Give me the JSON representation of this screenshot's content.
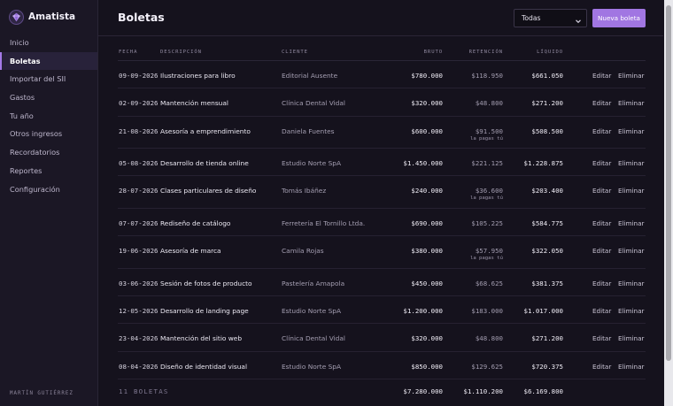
{
  "app": {
    "name": "Amatista"
  },
  "sidebar": {
    "items": [
      {
        "label": "Inicio",
        "name": "inicio"
      },
      {
        "label": "Boletas",
        "name": "boletas",
        "active": true
      },
      {
        "label": "Importar del SII",
        "name": "importar-sii"
      },
      {
        "label": "Gastos",
        "name": "gastos"
      },
      {
        "label": "Tu año",
        "name": "tu-ano"
      },
      {
        "label": "Otros ingresos",
        "name": "otros-ingresos"
      },
      {
        "label": "Recordatorios",
        "name": "recordatorios"
      },
      {
        "label": "Reportes",
        "name": "reportes"
      },
      {
        "label": "Configuración",
        "name": "configuracion"
      }
    ],
    "user": "MARTÍN GUTIÉRREZ"
  },
  "header": {
    "title": "Boletas",
    "filter_value": "Todas",
    "new_button": "Nueva boleta"
  },
  "table": {
    "columns": {
      "fecha": "FECHA",
      "descripcion": "DESCRIPCIÓN",
      "cliente": "CLIENTE",
      "bruto": "BRUTO",
      "retencion": "RETENCIÓN",
      "liquido": "LÍQUIDO"
    },
    "edit_label": "Editar",
    "delete_label": "Eliminar",
    "rows": [
      {
        "fecha": "09-09-2026",
        "descripcion": "Ilustraciones para libro",
        "cliente": "Editorial Ausente",
        "bruto": "$780.000",
        "retencion": "$118.950",
        "liquido": "$661.050",
        "nota": ""
      },
      {
        "fecha": "02-09-2026",
        "descripcion": "Mantención mensual",
        "cliente": "Clínica Dental Vidal",
        "bruto": "$320.000",
        "retencion": "$48.800",
        "liquido": "$271.200",
        "nota": ""
      },
      {
        "fecha": "21-08-2026",
        "descripcion": "Asesoría a emprendimiento",
        "cliente": "Daniela Fuentes",
        "bruto": "$600.000",
        "retencion": "$91.500",
        "liquido": "$508.500",
        "nota": "la pagas tú"
      },
      {
        "fecha": "05-08-2026",
        "descripcion": "Desarrollo de tienda online",
        "cliente": "Estudio Norte SpA",
        "bruto": "$1.450.000",
        "retencion": "$221.125",
        "liquido": "$1.228.875",
        "nota": ""
      },
      {
        "fecha": "28-07-2026",
        "descripcion": "Clases particulares de diseño",
        "cliente": "Tomás Ibáñez",
        "bruto": "$240.000",
        "retencion": "$36.600",
        "liquido": "$203.400",
        "nota": "la pagas tú"
      },
      {
        "fecha": "07-07-2026",
        "descripcion": "Rediseño de catálogo",
        "cliente": "Ferretería El Tornillo Ltda.",
        "bruto": "$690.000",
        "retencion": "$105.225",
        "liquido": "$584.775",
        "nota": ""
      },
      {
        "fecha": "19-06-2026",
        "descripcion": "Asesoría de marca",
        "cliente": "Camila Rojas",
        "bruto": "$380.000",
        "retencion": "$57.950",
        "liquido": "$322.050",
        "nota": "la pagas tú"
      },
      {
        "fecha": "03-06-2026",
        "descripcion": "Sesión de fotos de producto",
        "cliente": "Pastelería Amapola",
        "bruto": "$450.000",
        "retencion": "$68.625",
        "liquido": "$381.375",
        "nota": ""
      },
      {
        "fecha": "12-05-2026",
        "descripcion": "Desarrollo de landing page",
        "cliente": "Estudio Norte SpA",
        "bruto": "$1.200.000",
        "retencion": "$183.000",
        "liquido": "$1.017.000",
        "nota": ""
      },
      {
        "fecha": "23-04-2026",
        "descripcion": "Mantención del sitio web",
        "cliente": "Clínica Dental Vidal",
        "bruto": "$320.000",
        "retencion": "$48.800",
        "liquido": "$271.200",
        "nota": ""
      },
      {
        "fecha": "08-04-2026",
        "descripcion": "Diseño de identidad visual",
        "cliente": "Estudio Norte SpA",
        "bruto": "$850.000",
        "retencion": "$129.625",
        "liquido": "$720.375",
        "nota": ""
      }
    ],
    "footer": {
      "count": "11 BOLETAS",
      "bruto": "$7.280.000",
      "retencion": "$1.110.200",
      "liquido": "$6.169.800"
    }
  },
  "colors": {
    "accent": "#a176e2",
    "background": "#15121d",
    "sidebar": "#1b1725"
  },
  "icons": {
    "brand": "amethyst-gem-icon",
    "filter": "chevron-down-icon"
  }
}
